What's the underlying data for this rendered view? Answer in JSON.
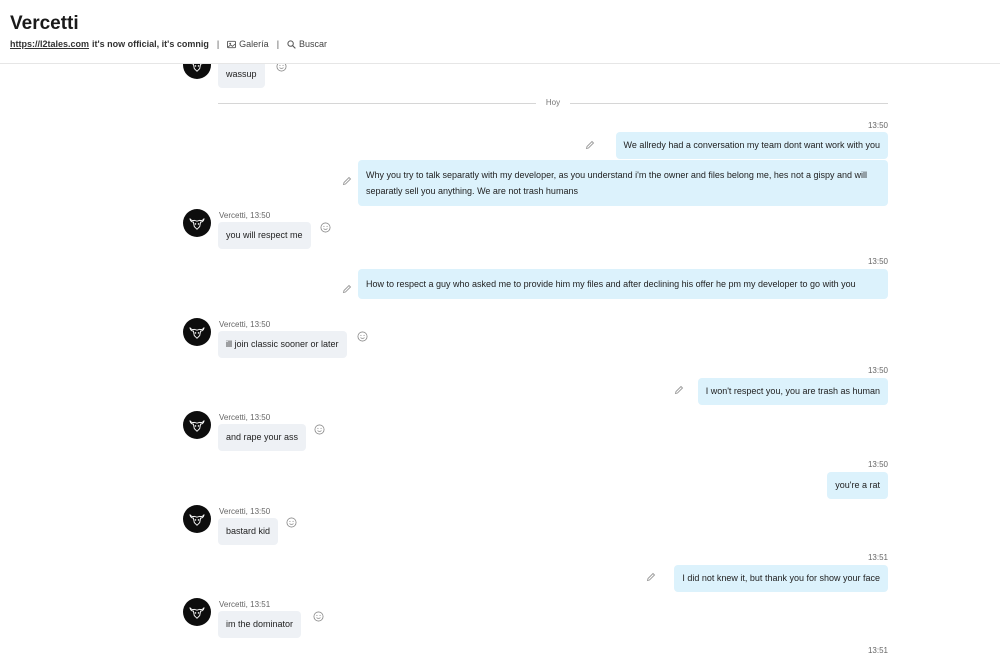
{
  "header": {
    "title": "Vercetti",
    "link_text": "https://l2tales.com",
    "tagline": "it's now official, it's comnig",
    "gallery_label": "Galería",
    "search_label": "Buscar",
    "separator": "|"
  },
  "chat": {
    "divider_label": "Hoy",
    "messages": [
      {
        "dir": "in",
        "text": "wassup"
      },
      {
        "dir": "out",
        "time": "13:50",
        "text": "We allredy had a conversation my team dont want work with you"
      },
      {
        "dir": "out",
        "text": "Why you try to talk separatly with my developer, as you understand i'm the owner and files belong me, hes not a gispy and will separatly sell you anything. We are not trash humans"
      },
      {
        "dir": "in",
        "meta": "Vercetti, 13:50",
        "text": "you will respect me"
      },
      {
        "dir": "out",
        "time": "13:50",
        "text": "How to respect a guy who asked me to provide him my files and after declining his offer he pm my developer to go with you"
      },
      {
        "dir": "in",
        "meta": "Vercetti, 13:50",
        "text": "ill join classic sooner or later"
      },
      {
        "dir": "out",
        "time": "13:50",
        "text": "I won't respect you, you are trash as human"
      },
      {
        "dir": "in",
        "meta": "Vercetti, 13:50",
        "text": "and rape your ass"
      },
      {
        "dir": "out",
        "time": "13:50",
        "text": "you're a rat"
      },
      {
        "dir": "in",
        "meta": "Vercetti, 13:50",
        "text": "bastard kid"
      },
      {
        "dir": "out",
        "time": "13:51",
        "text": "I did not knew it, but thank you for show your face"
      },
      {
        "dir": "in",
        "meta": "Vercetti, 13:51",
        "text": "im the dominator"
      },
      {
        "dir": "out",
        "time": "13:51"
      }
    ]
  },
  "colors": {
    "incoming_bubble": "#eef1f5",
    "outgoing_bubble": "#dcf2fc",
    "avatar": "#0d0d0d"
  },
  "icons": {
    "gallery": "image-icon",
    "search": "search-icon",
    "react": "smiley-icon",
    "edit": "pencil-icon",
    "avatar": "bull-skull-icon"
  }
}
